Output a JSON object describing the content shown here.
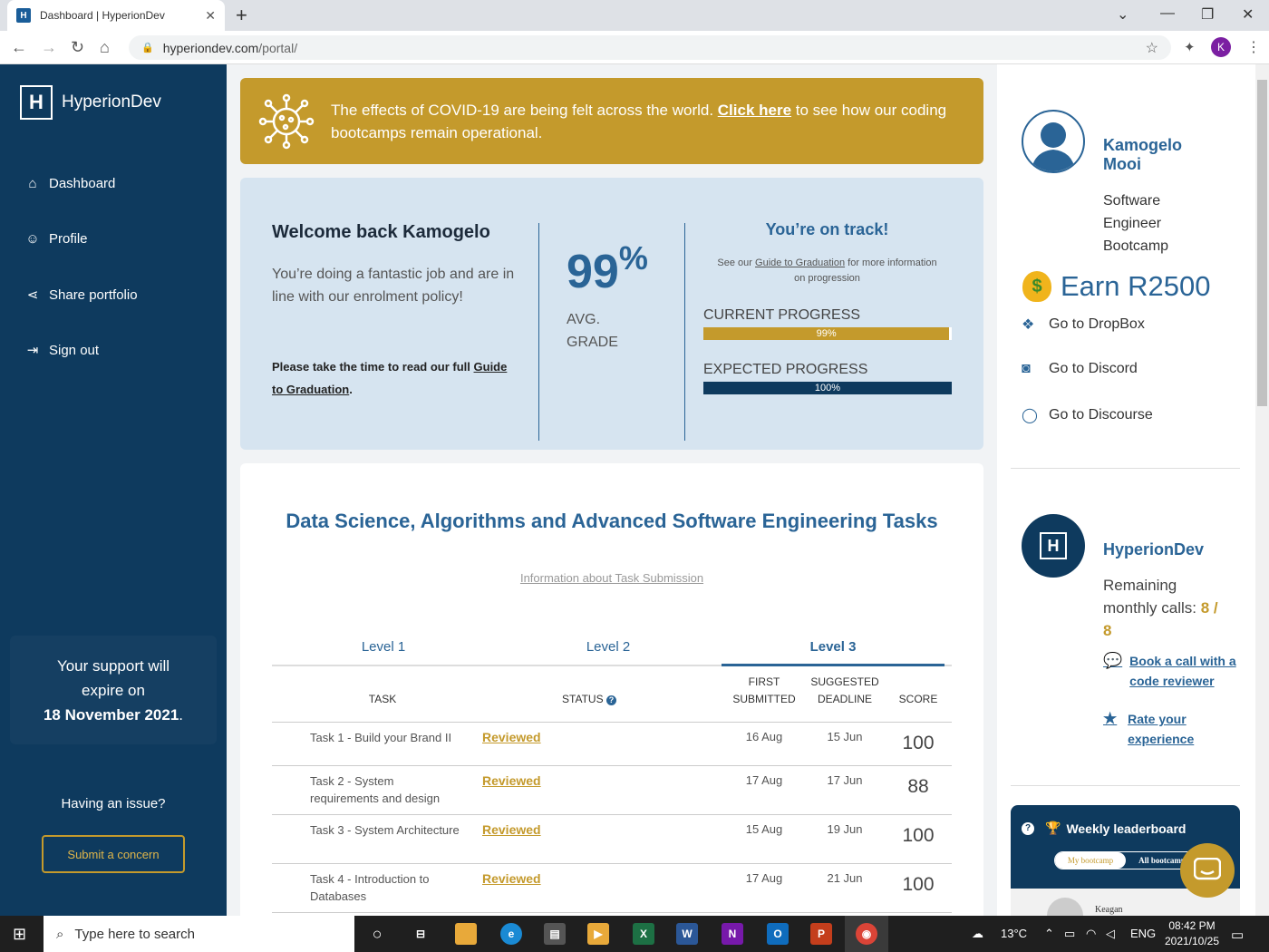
{
  "browser": {
    "tab_title": "Dashboard | HyperionDev",
    "favicon": "H",
    "url_host": "hyperiondev.com",
    "url_path": "/portal/",
    "profile_initial": "K"
  },
  "sidebar": {
    "brand": "HyperionDev",
    "items": [
      {
        "label": "Dashboard",
        "icon": "home-icon"
      },
      {
        "label": "Profile",
        "icon": "user-icon"
      },
      {
        "label": "Share portfolio",
        "icon": "share-icon"
      },
      {
        "label": "Sign out",
        "icon": "sign-out-icon"
      }
    ],
    "support_line1": "Your support will",
    "support_line2": "expire on",
    "support_date": "18 November 2021",
    "support_end": ".",
    "issue_text": "Having an issue?",
    "concern_button": "Submit a concern"
  },
  "banner": {
    "text_before": "The effects of COVID-19 are being felt across the world. ",
    "link": "Click here",
    "text_after": " to see how our coding bootcamps remain operational."
  },
  "welcome": {
    "title": "Welcome back Kamogelo",
    "message": "You’re doing a fantastic job and are in line with our enrolment policy!",
    "guide_prefix": "Please take the time to read our full ",
    "guide_link": "Guide to Graduation",
    "guide_suffix": ".",
    "grade_value": "99",
    "grade_unit": "%",
    "grade_label_1": "AVG.",
    "grade_label_2": "GRADE",
    "status": "You’re on track!",
    "see_our_prefix": "See our ",
    "see_our_link": "Guide to Graduation",
    "see_our_suffix": " for more information on progression",
    "current_label": "CURRENT PROGRESS",
    "current_text": "99%",
    "current_value": 0.99,
    "expected_label": "EXPECTED PROGRESS",
    "expected_text": "100%",
    "expected_value": 1.0
  },
  "tasks": {
    "title": "Data Science, Algorithms and Advanced Software Engineering Tasks",
    "info_link": "Information about Task Submission",
    "levels": [
      "Level 1",
      "Level 2",
      "Level 3"
    ],
    "active_level": "Level 3",
    "headers": {
      "task": "TASK",
      "status": "STATUS",
      "first_1": "FIRST",
      "first_2": "SUBMITTED",
      "deadline_1": "SUGGESTED",
      "deadline_2": "DEADLINE",
      "score": "SCORE"
    },
    "rows": [
      {
        "name": "Task 1 - Build your Brand II",
        "status": "Reviewed",
        "submitted": "16 Aug",
        "deadline": "15 Jun",
        "score": "100"
      },
      {
        "name": "Task 2 - System requirements and design",
        "status": "Reviewed",
        "submitted": "17 Aug",
        "deadline": "17 Jun",
        "score": "88"
      },
      {
        "name": "Task 3 - System Architecture",
        "status": "Reviewed",
        "submitted": "15 Aug",
        "deadline": "19 Jun",
        "score": "100"
      },
      {
        "name": "Task 4 - Introduction to Databases",
        "status": "Reviewed",
        "submitted": "17 Aug",
        "deadline": "21 Jun",
        "score": "100"
      }
    ]
  },
  "profile": {
    "name": "Kamogelo Mooi",
    "role": "Software Engineer Bootcamp",
    "earn": "Earn R2500",
    "links": [
      {
        "label": "Go to DropBox",
        "icon": "dropbox-icon"
      },
      {
        "label": "Go to Discord",
        "icon": "discord-icon"
      },
      {
        "label": "Go to Discourse",
        "icon": "discourse-icon"
      }
    ]
  },
  "mentor": {
    "name": "HyperionDev",
    "remaining_label": "Remaining monthly calls:",
    "remaining_value": "8 / 8",
    "book_call": "Book a call with a code reviewer",
    "rate": "Rate your experience"
  },
  "leaderboard": {
    "title": "Weekly leaderboard",
    "tab_active": "My bootcamp",
    "tab_other": "All bootcamp",
    "first_name": "Keagan"
  },
  "taskbar": {
    "search_placeholder": "Type here to search",
    "weather": "13°C",
    "lang": "ENG",
    "time": "08:42 PM",
    "date": "2021/10/25"
  },
  "colors": {
    "navy": "#0e3a5e",
    "gold": "#c49a2c",
    "blue": "#2a6496",
    "light_blue": "#d6e4f0"
  }
}
